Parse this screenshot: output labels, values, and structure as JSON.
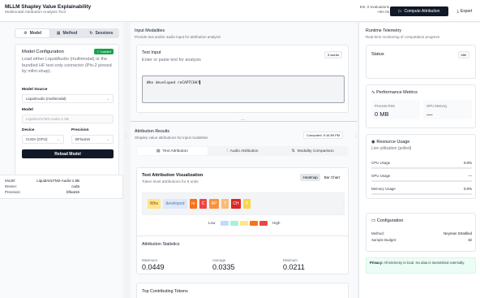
{
  "header": {
    "title": "MLLM Shapley Value Explainability",
    "subtitle": "Multimodal Attribution Analysis Tool",
    "eval_line1": "Est. 0 evaluations",
    "eval_line2": "~0m 0s",
    "compute_label": "Compute Attribution",
    "export_label": "Export"
  },
  "sidebar": {
    "tabs": [
      {
        "label": "Model",
        "icon": "gear-icon",
        "active": true
      },
      {
        "label": "Method",
        "icon": "grid-icon",
        "active": false
      },
      {
        "label": "Sessions",
        "icon": "history-icon",
        "active": false
      }
    ],
    "model_config": {
      "title": "Model Configuration",
      "status": "Loaded",
      "description": "Load either LiquidAudio (multimodal) or the bundled HF text-only connector (Phi-2 pinned by mllm-shap).",
      "source_label": "Model Source",
      "source_value": "LiquidAudio (multimodal)",
      "model_label": "Model",
      "model_placeholder": "LiquidAI/LFM2-Audio-1.5B",
      "device_label": "Device",
      "device_value": "CUDA (GPU)",
      "precision_label": "Precision",
      "precision_value": "BFloat16",
      "reload_label": "Reload Model"
    },
    "info": [
      {
        "key": "Model:",
        "value": "LiquidAI/LFM2-Audio-1.5B"
      },
      {
        "key": "Device:",
        "value": "cuda"
      },
      {
        "key": "Precision:",
        "value": "bfloat16"
      }
    ]
  },
  "main": {
    "input_title": "Input Modalities",
    "input_subtitle": "Provide text and/or audio input for attribution analysis",
    "text_input_title": "Text Input",
    "text_input_hint": "Enter or paste text for analysis",
    "words_badge": "3 words",
    "text_value": "Who developed reCAPTCHA?",
    "results_title": "Attribution Results",
    "results_subtitle": "Shapley value attributions for input modalities",
    "computed": "Computed: 9:16:59 PM",
    "tabs": [
      {
        "label": "Text Attribution",
        "icon": "document-icon",
        "active": true
      },
      {
        "label": "Audio Attribution",
        "icon": "waveform-icon",
        "active": false
      },
      {
        "label": "Modality Comparison",
        "icon": "compare-icon",
        "active": false
      }
    ],
    "viz": {
      "title": "Text Attribution Visualization",
      "subtitle": "Token level attributions for 8 units",
      "view_heatmap": "Heatmap",
      "view_bar": "Bar Chart",
      "tokens": [
        {
          "text": "Who",
          "color": "#fde68a",
          "fg": "#92400e"
        },
        {
          "text": "developed",
          "color": "#dbeafe",
          "fg": "#6b7280"
        },
        {
          "text": "re",
          "color": "#f97316",
          "fg": "#ffffff"
        },
        {
          "text": "C",
          "color": "#ef4444",
          "fg": "#ffffff"
        },
        {
          "text": "AP",
          "color": "#fb923c",
          "fg": "#ffffff"
        },
        {
          "text": "T",
          "color": "#fdba74",
          "fg": "#ffffff"
        },
        {
          "text": "CH",
          "color": "#dc2626",
          "fg": "#ffffff"
        },
        {
          "text": "A",
          "color": "#fcd34d",
          "fg": "#ffffff"
        }
      ],
      "legend_low": "Low",
      "legend_high": "High",
      "legend_colors": [
        "#bfdbfe",
        "#a7f3d0",
        "#fde68a",
        "#f97316",
        "#ef4444"
      ]
    },
    "stats": {
      "title": "Attribution Statistics",
      "items": [
        {
          "label": "Maximum",
          "value": "0.0449"
        },
        {
          "label": "Average",
          "value": "0.0335"
        },
        {
          "label": "Minimum",
          "value": "0.0211"
        }
      ]
    },
    "top_tokens_title": "Top Contributing Tokens"
  },
  "right": {
    "title": "Runtime Telemetry",
    "subtitle": "Real-time monitoring of computation progress",
    "status_label": "Status",
    "status_value": "Idle",
    "perf_title": "Performance Metrics",
    "process_rss_label": "Process RSS",
    "process_rss_value": "0 MB",
    "gpu_mem_label": "GPU Memory",
    "gpu_mem_value": "—",
    "resource_title": "Resource Usage",
    "resource_subtitle": "Live utilization (polled)",
    "resources": [
      {
        "label": "CPU Usage",
        "value": "0.0%"
      },
      {
        "label": "GPU Usage",
        "value": "—"
      },
      {
        "label": "Memory Usage",
        "value": "0.0%"
      }
    ],
    "config_title": "Configuration",
    "config": [
      {
        "key": "Method:",
        "value": "Neyman Stratified"
      },
      {
        "key": "Sample Budget:",
        "value": "32"
      }
    ],
    "privacy_bold": "Privacy:",
    "privacy_text": "All telemetry is local. No data is transmitted externally."
  }
}
